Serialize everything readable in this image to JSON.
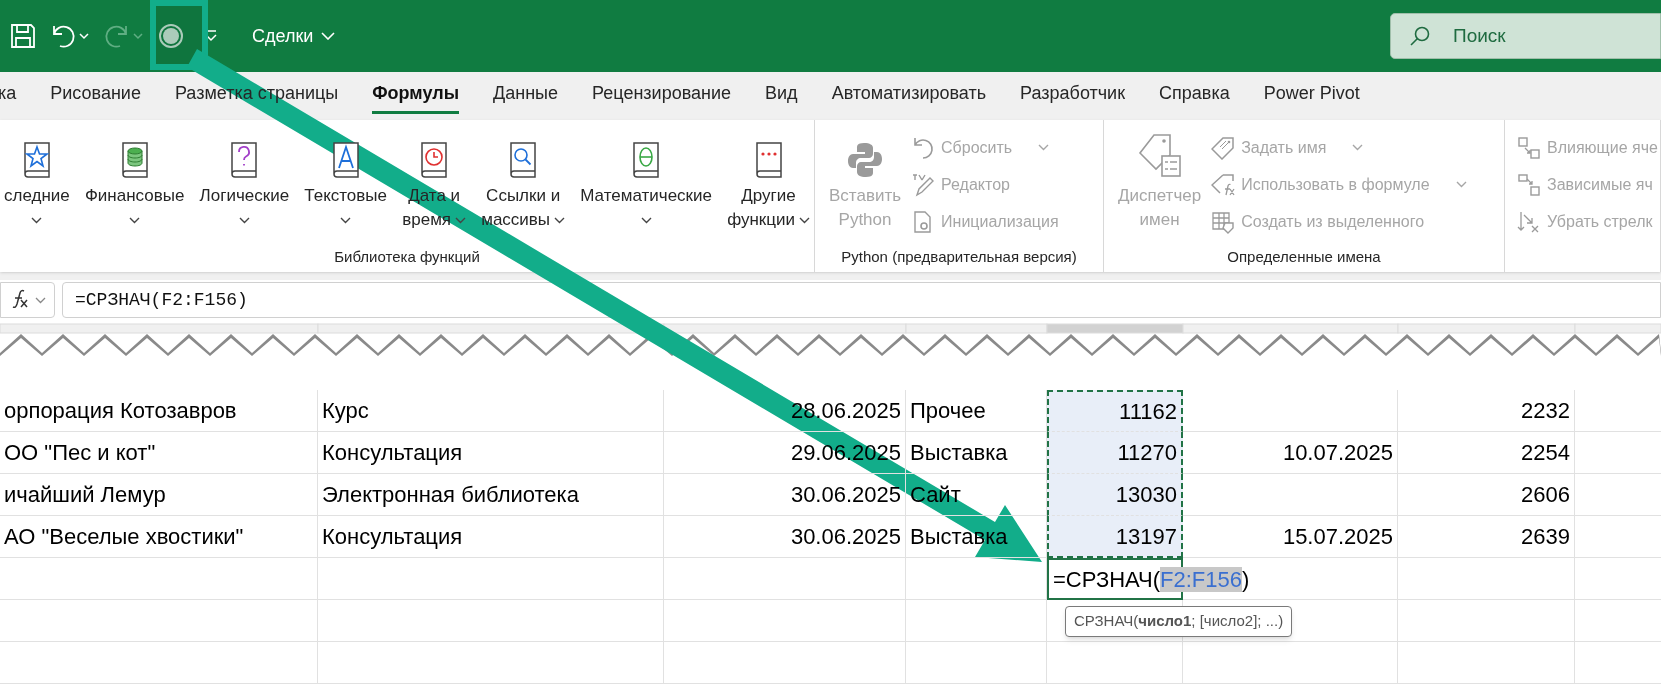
{
  "quick_access": [
    {
      "kind": "save",
      "disabled": false
    },
    {
      "kind": "undo",
      "disabled": false
    },
    {
      "kind": "redo",
      "disabled": true
    },
    {
      "kind": "record",
      "disabled": false
    }
  ],
  "document_title": "Сделки",
  "search": {
    "placeholder": "Поиск"
  },
  "tabs": [
    {
      "label": "ка",
      "selected": false
    },
    {
      "label": "Рисование",
      "selected": false
    },
    {
      "label": "Разметка страницы",
      "selected": false
    },
    {
      "label": "Формулы",
      "selected": true
    },
    {
      "label": "Данные",
      "selected": false
    },
    {
      "label": "Рецензирование",
      "selected": false
    },
    {
      "label": "Вид",
      "selected": false
    },
    {
      "label": "Автоматизировать",
      "selected": false
    },
    {
      "label": "Разработчик",
      "selected": false
    },
    {
      "label": "Справка",
      "selected": false
    },
    {
      "label": "Power Pivot",
      "selected": false
    }
  ],
  "ribbon": [
    {
      "label": "Библиотека функций",
      "items": [
        {
          "kind": "star",
          "label": "следние",
          "dropdown": true,
          "disabled": false
        },
        {
          "kind": "coins",
          "label": "Финансовые",
          "dropdown": true,
          "disabled": false
        },
        {
          "kind": "question",
          "label": "Логические",
          "dropdown": true,
          "disabled": false
        },
        {
          "kind": "letter",
          "label": "Текстовые",
          "dropdown": true,
          "disabled": false
        },
        {
          "kind": "clock",
          "label": "Дата и\nвремя",
          "dropdown": true,
          "disabled": false
        },
        {
          "kind": "magnifier",
          "label": "Ссылки и\nмассивы",
          "dropdown": true,
          "disabled": false
        },
        {
          "kind": "theta",
          "label": "Математические",
          "dropdown": true,
          "disabled": false
        },
        {
          "kind": "dots",
          "label": "Другие\nфункции",
          "dropdown": true,
          "disabled": false
        }
      ]
    },
    {
      "label": "Python (предварительная версия)",
      "items": [
        {
          "kind": "python",
          "label": "Вставить\nPython",
          "dropdown": false,
          "disabled": true
        },
        {
          "kind": "reset",
          "label": "Сбросить",
          "dropdown": true,
          "disabled": true
        },
        {
          "kind": "editor",
          "label": "Редактор",
          "dropdown": false,
          "disabled": true
        },
        {
          "kind": "init",
          "label": "Инициализация",
          "dropdown": false,
          "disabled": true
        }
      ]
    },
    {
      "label": "Определенные имена",
      "items": [
        {
          "kind": "name_manager",
          "label": "Диспетчер\nимен",
          "dropdown": false,
          "disabled": true
        },
        {
          "kind": "tag",
          "label": "Задать имя",
          "dropdown": true,
          "disabled": true
        },
        {
          "kind": "tag_fx",
          "label": "Использовать в формуле",
          "dropdown": true,
          "disabled": true
        },
        {
          "kind": "table_tag",
          "label": "Создать из выделенного",
          "dropdown": false,
          "disabled": true
        }
      ]
    },
    {
      "items": [
        {
          "kind": "precedents",
          "label": "Влияющие яче",
          "dropdown": false,
          "disabled": true
        },
        {
          "kind": "dependents",
          "label": "Зависимые яч",
          "dropdown": false,
          "disabled": true
        },
        {
          "kind": "remove_arrows",
          "label": "Убрать стрелк",
          "dropdown": false,
          "disabled": true
        }
      ]
    }
  ],
  "formula_bar": {
    "formula": "=СРЗНАЧ(F2:F156)"
  },
  "sheet": {
    "columns": [
      {
        "selected": false
      },
      {
        "selected": false
      },
      {
        "selected": false
      },
      {
        "selected": false
      },
      {
        "selected": true
      },
      {
        "selected": false
      },
      {
        "selected": false
      },
      {
        "selected": false
      }
    ],
    "rows": [
      {
        "cells": [
          {
            "text": "орпорация Котозавров",
            "selected": false
          },
          {
            "text": "Курс",
            "selected": false
          },
          {
            "text": "28.06.2025",
            "selected": false
          },
          {
            "text": "Прочее",
            "selected": false
          },
          {
            "text": "11162",
            "selected": true
          },
          {
            "selected": false
          },
          {
            "text": "2232",
            "selected": false
          },
          {
            "selected": false
          }
        ]
      },
      {
        "cells": [
          {
            "text": "ОО \"Пес и кот\"",
            "selected": false
          },
          {
            "text": "Консультация",
            "selected": false
          },
          {
            "text": "29.06.2025",
            "selected": false
          },
          {
            "text": "Выставка",
            "selected": false
          },
          {
            "text": "11270",
            "selected": true
          },
          {
            "text": "10.07.2025",
            "selected": false
          },
          {
            "text": "2254",
            "selected": false
          },
          {
            "selected": false
          }
        ]
      },
      {
        "cells": [
          {
            "text": "ичайший Лемур",
            "selected": false
          },
          {
            "text": "Электронная библиотека",
            "selected": false
          },
          {
            "text": "30.06.2025",
            "selected": false
          },
          {
            "text": "Сайт",
            "selected": false
          },
          {
            "text": "13030",
            "selected": true
          },
          {
            "selected": false
          },
          {
            "text": "2606",
            "selected": false
          },
          {
            "selected": false
          }
        ]
      },
      {
        "cells": [
          {
            "text": "АО \"Веселые хвостики\"",
            "selected": false
          },
          {
            "text": "Консультация",
            "selected": false
          },
          {
            "text": "30.06.2025",
            "selected": false
          },
          {
            "text": "Выставка",
            "selected": false
          },
          {
            "text": "13197",
            "selected": true
          },
          {
            "text": "15.07.2025",
            "selected": false
          },
          {
            "text": "2639",
            "selected": false
          },
          {
            "selected": false
          }
        ]
      },
      {
        "cells": [
          {
            "selected": false
          },
          {
            "selected": false
          },
          {
            "selected": false
          },
          {
            "selected": false
          },
          {
            "kind": "edit",
            "before": "=СРЗНАЧ(",
            "reference": "F2:F156",
            "after": ")",
            "tooltip": "СРЗНАЧ(**число1**; [число2]; ...)"
          },
          {
            "selected": false
          },
          {
            "selected": false
          },
          {
            "selected": false
          }
        ]
      }
    ]
  }
}
